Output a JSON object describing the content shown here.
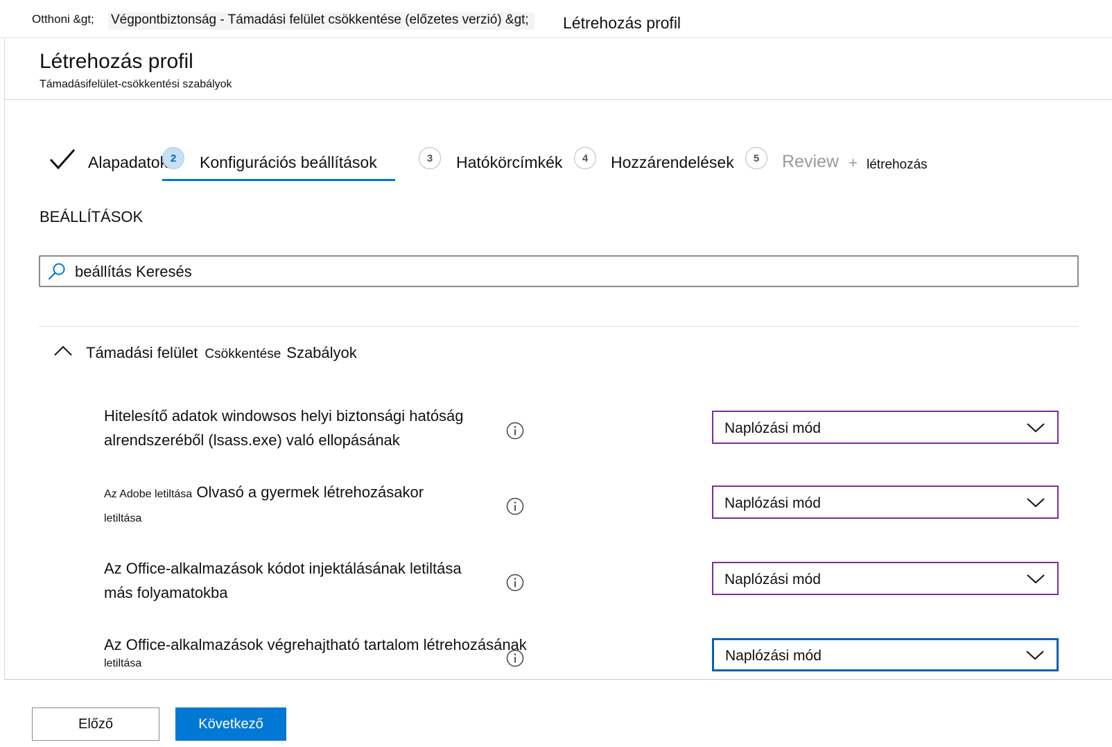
{
  "breadcrumb": {
    "home": "Otthoni &gt;",
    "endpoint": "Végpontbiztonság - Támadási felület csökkentése (előzetes verzió) &gt;",
    "current": "Létrehozás profil"
  },
  "header": {
    "title": "Létrehozás profil",
    "subtitle": "Támadásifelület-csökkentési szabályok"
  },
  "wizard": {
    "steps": [
      {
        "number": "",
        "label": "Alapadatok",
        "state": "completed"
      },
      {
        "number": "2",
        "label": "Konfigurációs beállítások",
        "state": "active"
      },
      {
        "number": "3",
        "label": "Hatókörcímkék",
        "state": "pending"
      },
      {
        "number": "4",
        "label": "Hozzárendelések",
        "state": "pending"
      },
      {
        "number": "5",
        "label": "Review",
        "state": "disabled"
      }
    ],
    "review_plus": "+",
    "review_create": "létrehozás"
  },
  "settings": {
    "heading": "BEÁLLÍTÁSOK",
    "search_placeholder": "beállítás Keresés"
  },
  "group": {
    "title_part1": "Támadási felület",
    "title_part2": "Csökkentése",
    "title_part3": "Szabályok",
    "expanded": true
  },
  "rows": [
    {
      "line1": "Hitelesítő adatok windowsos helyi biztonsági hatóság",
      "line2": "alrendszeréből (lsass.exe) való ellopásának",
      "value": "Naplózási mód"
    },
    {
      "line1_small": "Az Adobe letiltása",
      "line1": "Olvasó a gyermek létrehozásakor",
      "line2_small": "letiltása",
      "value": "Naplózási mód"
    },
    {
      "line1": "Az Office-alkalmazások kódot injektálásának letiltása",
      "line2": "más folyamatokba",
      "value": "Naplózási mód"
    },
    {
      "line1": "Az Office-alkalmazások végrehajtható tartalom létrehozásának",
      "line2_small": "letiltása",
      "value": "Naplózási mód"
    }
  ],
  "footer": {
    "previous": "Előző",
    "next": "Következő"
  },
  "colors": {
    "accent": "#0078d4",
    "select_border": "#7a2d9b",
    "active_step_circle": "#c7e0f4"
  }
}
